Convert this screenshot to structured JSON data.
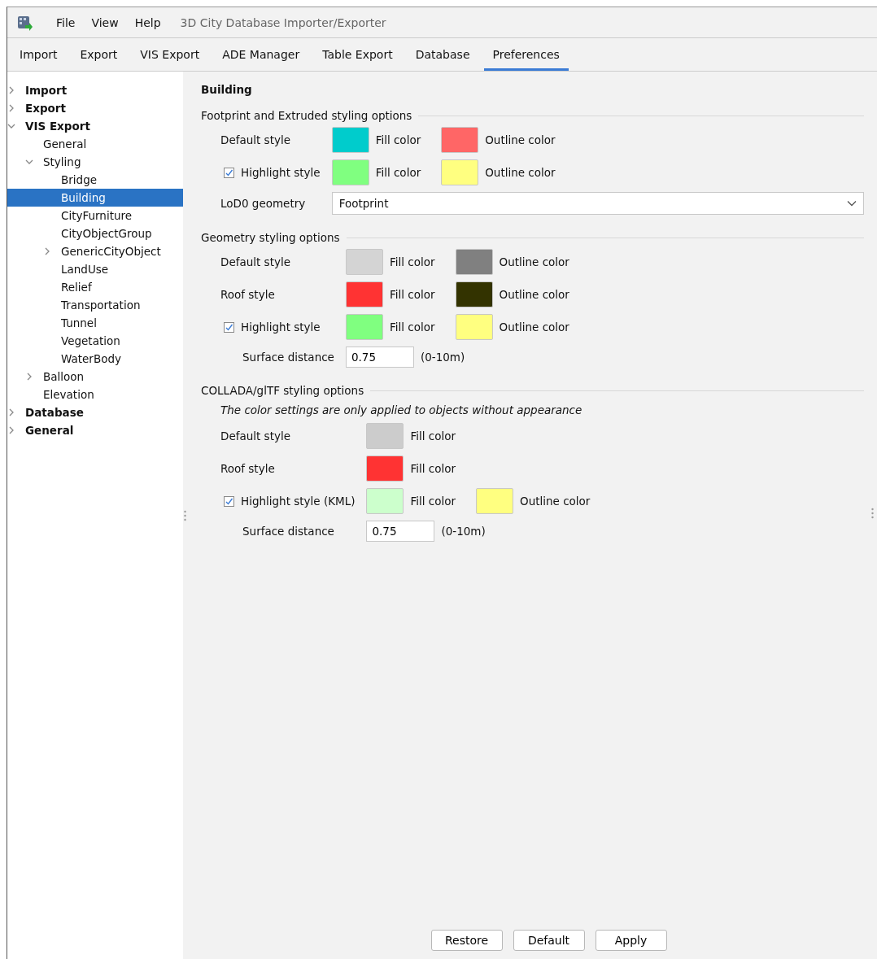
{
  "window": {
    "title": "3D City Database Importer/Exporter"
  },
  "menu": [
    "File",
    "View",
    "Help"
  ],
  "tabs": [
    {
      "label": "Import",
      "selected": false
    },
    {
      "label": "Export",
      "selected": false
    },
    {
      "label": "VIS Export",
      "selected": false
    },
    {
      "label": "ADE Manager",
      "selected": false
    },
    {
      "label": "Table Export",
      "selected": false
    },
    {
      "label": "Database",
      "selected": false
    },
    {
      "label": "Preferences",
      "selected": true
    }
  ],
  "tree": [
    {
      "label": "Import",
      "expanded": false,
      "selected": false
    },
    {
      "label": "Export",
      "expanded": false,
      "selected": false
    },
    {
      "label": "VIS Export",
      "expanded": true,
      "selected": false,
      "children": [
        {
          "label": "General",
          "selected": false
        },
        {
          "label": "Styling",
          "expanded": true,
          "selected": false,
          "children": [
            {
              "label": "Bridge",
              "selected": false
            },
            {
              "label": "Building",
              "selected": true
            },
            {
              "label": "CityFurniture",
              "selected": false
            },
            {
              "label": "CityObjectGroup",
              "selected": false
            },
            {
              "label": "GenericCityObject",
              "expanded": false,
              "selected": false
            },
            {
              "label": "LandUse",
              "selected": false
            },
            {
              "label": "Relief",
              "selected": false
            },
            {
              "label": "Transportation",
              "selected": false
            },
            {
              "label": "Tunnel",
              "selected": false
            },
            {
              "label": "Vegetation",
              "selected": false
            },
            {
              "label": "WaterBody",
              "selected": false
            }
          ]
        },
        {
          "label": "Balloon",
          "expanded": false,
          "selected": false
        },
        {
          "label": "Elevation",
          "selected": false
        }
      ]
    },
    {
      "label": "Database",
      "expanded": false,
      "selected": false
    },
    {
      "label": "General",
      "expanded": false,
      "selected": false
    }
  ],
  "panel": {
    "title": "Building",
    "sections": [
      {
        "title": "Footprint and Extruded styling options",
        "rows": [
          {
            "kind": "style",
            "label": "Default style",
            "swatches": [
              {
                "color": "#00cccc",
                "label": "Fill color"
              },
              {
                "color": "#ff6666",
                "label": "Outline color"
              }
            ]
          },
          {
            "kind": "style",
            "label": "Highlight style",
            "checked": true,
            "swatches": [
              {
                "color": "#80ff80",
                "label": "Fill color"
              },
              {
                "color": "#ffff80",
                "label": "Outline color"
              }
            ]
          },
          {
            "kind": "combo",
            "label": "LoD0 geometry",
            "value": "Footprint"
          }
        ]
      },
      {
        "title": "Geometry styling options",
        "rows": [
          {
            "kind": "style",
            "label": "Default style",
            "swatches": [
              {
                "color": "#d4d4d4",
                "label": "Fill color"
              },
              {
                "color": "#808080",
                "label": "Outline color"
              }
            ]
          },
          {
            "kind": "style",
            "label": "Roof style",
            "swatches": [
              {
                "color": "#ff3333",
                "label": "Fill color"
              },
              {
                "color": "#333300",
                "label": "Outline color"
              }
            ]
          },
          {
            "kind": "style",
            "label": "Highlight style",
            "checked": true,
            "swatches": [
              {
                "color": "#80ff80",
                "label": "Fill color"
              },
              {
                "color": "#ffff80",
                "label": "Outline color"
              }
            ]
          },
          {
            "kind": "distance",
            "label": "Surface distance",
            "value": "0.75",
            "range": "(0-10m)"
          }
        ]
      },
      {
        "title": "COLLADA/glTF styling options",
        "note": "The color settings are only applied to objects without appearance",
        "rows": [
          {
            "kind": "style",
            "label": "Default style",
            "swatches": [
              {
                "color": "#cccccc",
                "label": "Fill color"
              }
            ]
          },
          {
            "kind": "style",
            "label": "Roof style",
            "swatches": [
              {
                "color": "#ff3333",
                "label": "Fill color"
              }
            ]
          },
          {
            "kind": "style",
            "label": "Highlight style (KML)",
            "checked": true,
            "swatches": [
              {
                "color": "#ccffcc",
                "label": "Fill color"
              },
              {
                "color": "#ffff80",
                "label": "Outline color"
              }
            ]
          },
          {
            "kind": "distance",
            "label": "Surface distance",
            "value": "0.75",
            "range": "(0-10m)"
          }
        ]
      }
    ]
  },
  "buttons": [
    "Restore",
    "Default",
    "Apply"
  ]
}
